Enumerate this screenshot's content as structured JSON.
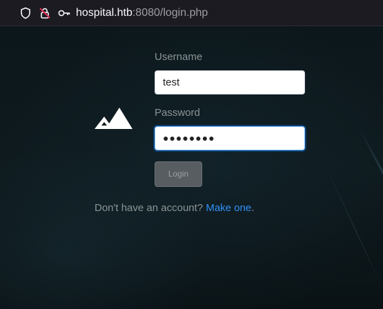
{
  "browser": {
    "url_host": "hospital.htb",
    "url_rest": ":8080/login.php",
    "icons": [
      "shield-icon",
      "lock-slash-icon",
      "key-icon"
    ]
  },
  "login": {
    "username_label": "Username",
    "username_value": "test",
    "password_label": "Password",
    "password_value": "●●●●●●●●",
    "login_button": "Login",
    "signup_prompt": "Don't have an account?",
    "signup_link": "Make one",
    "signup_period": "."
  },
  "colors": {
    "background": "#0b1418",
    "link": "#2f8ff5",
    "focus_border": "#80bdff",
    "button": "#575d61"
  }
}
